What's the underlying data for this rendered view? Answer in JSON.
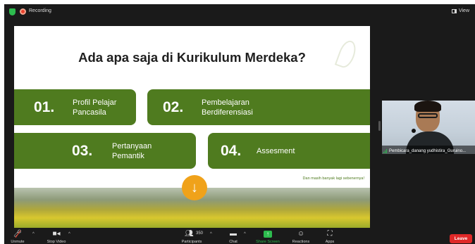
{
  "topbar": {
    "recording_label": "Recording",
    "view_label": "View",
    "icons": [
      "shield-icon",
      "record-icon",
      "view-icon"
    ]
  },
  "slide": {
    "title": "Ada apa saja di Kurikulum Merdeka?",
    "cards": [
      {
        "number": "01.",
        "label": "Profil Pelajar\nPancasila"
      },
      {
        "number": "02.",
        "label": "Pembelajaran\nBerdiferensiasi"
      },
      {
        "number": "03.",
        "label": "Pertanyaan\nPemantik"
      },
      {
        "number": "04.",
        "label": "Assesment"
      }
    ],
    "note": "Dan masih banyak lagi sebenernya!",
    "arrow_glyph": "↓",
    "colors": {
      "card": "#4f7b1f",
      "arrow": "#f0a21a"
    }
  },
  "participant": {
    "name": "Pembicara_danang yudhistira_Guruino..."
  },
  "toolbar": {
    "unmute": "Unmute",
    "stop_video": "Stop Video",
    "participants": "Participants",
    "participant_count": "350",
    "chat": "Chat",
    "share_screen": "Share Screen",
    "reactions": "Reactions",
    "apps": "Apps",
    "leave": "Leave",
    "caret": "^",
    "colors": {
      "share": "#2dbb4e",
      "leave": "#e02828"
    }
  }
}
